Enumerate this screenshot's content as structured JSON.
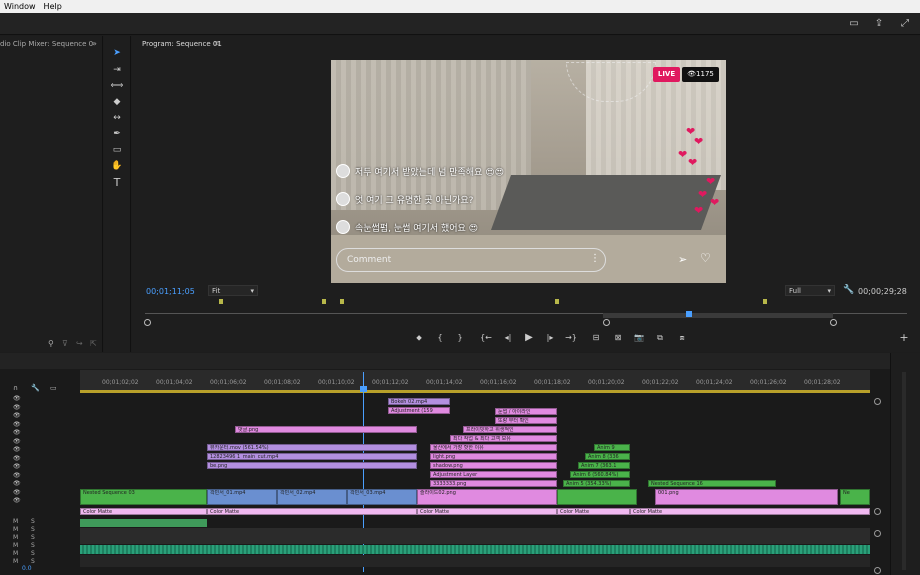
{
  "menu": [
    "Window",
    "Help"
  ],
  "left_panel": {
    "title": "dio Clip Mixer: Sequence 0"
  },
  "program": {
    "title": "Program: Sequence 01",
    "timecode_current": "00;01;11;05",
    "timecode_total": "00;00;29;28",
    "fit": "Fit",
    "quality": "Full"
  },
  "video": {
    "live_label": "LIVE",
    "viewers": "1175",
    "comments": [
      "저두 여기서 받았는데 넘 만족해요 😍😍",
      "엇 여기 그 유명한 곳 아닌가요?",
      "속눈썹펌, 눈썹 여기서 했어요 😍"
    ],
    "comment_placeholder": "Comment"
  },
  "timeline": {
    "ticks": [
      "00;01;02;02",
      "00;01;04;02",
      "00;01;06;02",
      "00;01;08;02",
      "00;01;10;02",
      "00;01;12;02",
      "00;01;14;02",
      "00;01;16;02",
      "00;01;18;02",
      "00;01;20;02",
      "00;01;22;02",
      "00;01;24;02",
      "00;01;26;02",
      "00;01;28;02"
    ],
    "clips": {
      "bokeh": "Bokeh 02.mp4",
      "adjust": "Adjustment (159",
      "c1": "눈썹 / 아이라인",
      "c2": "또랑 부터 확인",
      "c3": "프라이빗하고 위생적인",
      "c4": "최다 작업 & 최다 고객 보유",
      "c5": "울산에서 가장 핫한 이유",
      "like": "댓글.png",
      "pp": "뷰카운터.mov (561.54%)",
      "p2": "12823496 1_main_cut.mp4",
      "p3": "be.png",
      "light": "light.png",
      "shadow": "shadow.png",
      "adjlayer": "Adjustment Layer",
      "num": "3333333.png",
      "anim9": "Anim 9",
      "anim8": "Anim 8 (336",
      "anim7": "Anim 7 (363.1",
      "anim6": "Anim 6 (560.84%)",
      "anim5": "Anim 5 (354.33%)",
      "ns16": "Nested Sequence 16",
      "nested": "Nested Sequence 03",
      "pp1": "곽민서_01.mp4",
      "pp2": "곽민서_02.mp4",
      "pp3": "곽민서_03.mp4",
      "slide": "슬라이드02.png",
      "png001": "001.png",
      "ns": "Ne",
      "matte": "Color Matte"
    },
    "track_time": "0.0"
  }
}
